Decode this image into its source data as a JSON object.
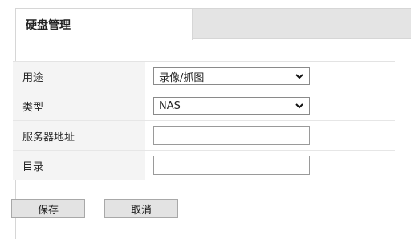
{
  "tab": {
    "title": "硬盘管理"
  },
  "form": {
    "rows": [
      {
        "label": "用途",
        "type": "select",
        "value": "录像/抓图"
      },
      {
        "label": "类型",
        "type": "select",
        "value": "NAS"
      },
      {
        "label": "服务器地址",
        "type": "input",
        "value": ""
      },
      {
        "label": "目录",
        "type": "input",
        "value": ""
      }
    ]
  },
  "buttons": {
    "save": "保存",
    "cancel": "取消"
  }
}
